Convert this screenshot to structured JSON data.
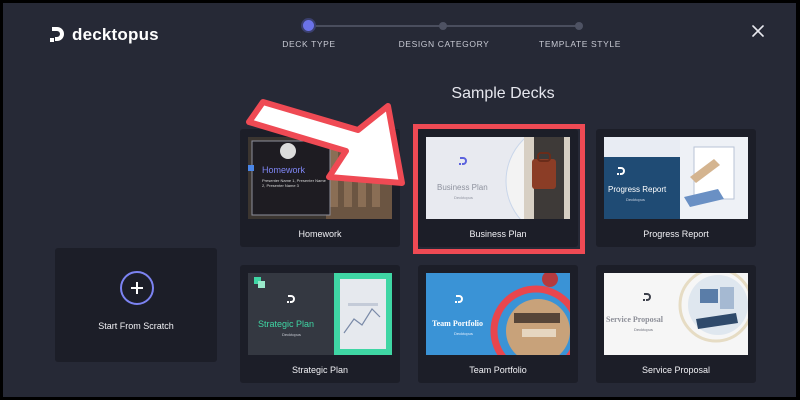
{
  "app": {
    "brand": "decktopus",
    "colors": {
      "background": "#262936",
      "card": "#1c1e28",
      "accent": "#6b72e8",
      "highlight": "#ef4a54"
    }
  },
  "stepper": {
    "steps": [
      {
        "label": "DECK TYPE",
        "state": "active"
      },
      {
        "label": "DESIGN CATEGORY",
        "state": "inactive"
      },
      {
        "label": "TEMPLATE STYLE",
        "state": "inactive"
      }
    ]
  },
  "header": {
    "close_icon": "close-icon"
  },
  "section": {
    "title": "Sample Decks"
  },
  "scratch": {
    "label": "Start From Scratch",
    "icon": "plus-circle-icon"
  },
  "decks": [
    {
      "label": "Homework",
      "thumb_title": "Homework",
      "thumb_sub": "Presenter Name 1, Presenter Name 2, Presenter Name 3"
    },
    {
      "label": "Business Plan",
      "thumb_title": "Business Plan",
      "thumb_sub": "Decktopus",
      "highlighted": true
    },
    {
      "label": "Progress Report",
      "thumb_title": "Progress Report",
      "thumb_sub": "Decktopus"
    },
    {
      "label": "Strategic Plan",
      "thumb_title": "Strategic Plan",
      "thumb_sub": "Decktopus"
    },
    {
      "label": "Team Portfolio",
      "thumb_title": "Team Portfolio",
      "thumb_sub": "Decktopus"
    },
    {
      "label": "Service Proposal",
      "thumb_title": "Service Proposal",
      "thumb_sub": "Decktopus"
    }
  ],
  "annotation": {
    "arrow_icon": "pointer-arrow-icon"
  }
}
